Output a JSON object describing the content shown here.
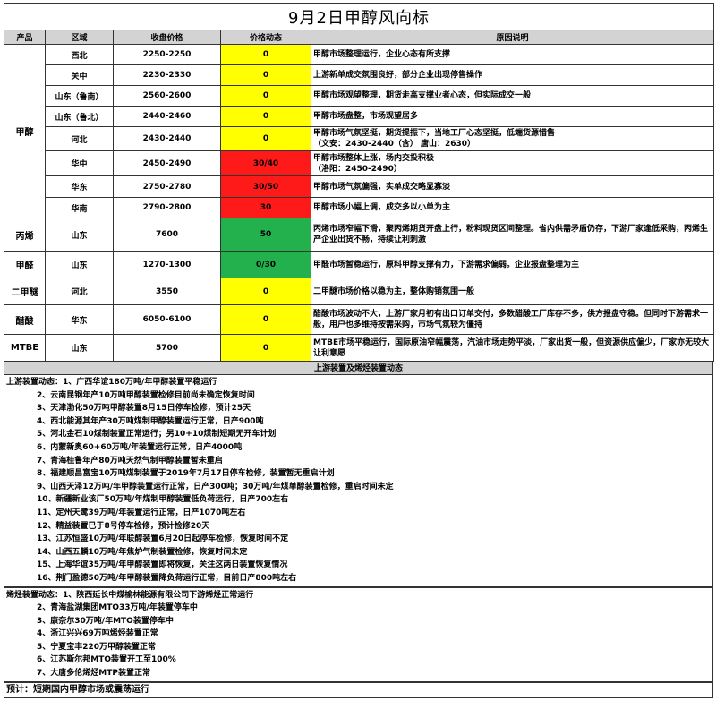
{
  "title": "9月2日甲醇风向标",
  "headers": [
    "产品",
    "区域",
    "收盘价格",
    "价格动态",
    "原因说明"
  ],
  "groups": [
    {
      "product": "甲醇",
      "rows": [
        {
          "region": "西北",
          "price": "2250-2250",
          "change": "0",
          "status": "yellow",
          "reason": "甲醇市场整理运行，企业心态有所支撑"
        },
        {
          "region": "关中",
          "price": "2230-2330",
          "change": "0",
          "status": "yellow",
          "reason": "上游新单成交氛围良好，部分企业出现停售操作"
        },
        {
          "region": "山东（鲁南）",
          "price": "2560-2600",
          "change": "0",
          "status": "yellow",
          "reason": "甲醇市场观望整理，期货走高支撑业者心态，但实际成交一般"
        },
        {
          "region": "山东（鲁北）",
          "price": "2440-2460",
          "change": "0",
          "status": "yellow",
          "reason": "甲醇市场盘整，市场观望居多"
        },
        {
          "region": "河北",
          "price": "2430-2440",
          "change": "0",
          "status": "yellow",
          "reason": "甲醇市场气氛坚挺，期货提振下，当地工厂心态坚挺，低端货源惜售\n（文安：2430-2440（含） 唐山：2630）"
        },
        {
          "region": "华中",
          "price": "2450-2490",
          "change": "30/40",
          "status": "red",
          "reason": "甲醇市场整体上涨，场内交投积极\n（洛阳：2450-2490）"
        },
        {
          "region": "华东",
          "price": "2750-2780",
          "change": "30/50",
          "status": "red",
          "reason": "甲醇市场气氛偏强，实单成交略显寡淡"
        },
        {
          "region": "华南",
          "price": "2790-2800",
          "change": "30",
          "status": "red",
          "reason": "甲醇市场小幅上调，成交多以小单为主"
        }
      ]
    },
    {
      "product": "丙烯",
      "rows": [
        {
          "region": "山东",
          "price": "7600",
          "change": "50",
          "status": "green",
          "reason": "丙烯市场窄幅下滑，聚丙烯期货开盘上行，粉料现货区间整理。省内供需矛盾仍存，下游厂家逢低采购，丙烯生产企业出货不畅，持续让利刺激"
        }
      ]
    },
    {
      "product": "甲醛",
      "rows": [
        {
          "region": "山东",
          "price": "1270-1300",
          "change": "0/30",
          "status": "green",
          "reason": "甲醛市场暂稳运行，原料甲醇支撑有力，下游需求偏弱。企业报盘整理为主"
        }
      ]
    },
    {
      "product": "二甲醚",
      "rows": [
        {
          "region": "河北",
          "price": "3550",
          "change": "0",
          "status": "yellow",
          "reason": "二甲醚市场价格以稳为主，整体购销氛围一般"
        }
      ]
    },
    {
      "product": "醋酸",
      "rows": [
        {
          "region": "华东",
          "price": "6050-6100",
          "change": "0",
          "status": "yellow",
          "reason": "醋酸市场波动不大，上游厂家月初有出口订单交付，多数醋酸工厂库存不多，供方报盘守稳。但同时下游需求一般，用户也多维持按需采购，市场气氛较为僵持"
        }
      ]
    },
    {
      "product": "MTBE",
      "rows": [
        {
          "region": "山东",
          "price": "5700",
          "change": "0",
          "status": "yellow",
          "reason": "MTBE市场平稳运行，国际原油窄幅震荡，汽油市场走势平淡，厂家出货一般，但资源供应偏少，厂家亦无较大让利意愿"
        }
      ]
    }
  ],
  "section_header": "上游装置及烯烃装置动态",
  "upstream": {
    "lead": "上游装置动态：1、广西华谊180万吨/年甲醇装置平稳运行",
    "items": [
      "2、云南昆钢年产10万吨甲醇装置检修目前尚未确定恢复时间",
      "3、天津渤化50万吨甲醇装置8月15日停车检修，预计25天",
      "4、西北能源其年产30万吨煤制甲醇装置运行正常，日产900吨",
      "5、河北金石10煤制装置正常运行；另10+10煤制短期无开车计划",
      "6、内蒙新奥60+60万吨/年装置运行正常，日产4000吨",
      "7、青海桂鲁年产80万吨天然气制甲醇装置暂未重启",
      "8、福建顺昌富宝10万吨煤制装置于2019年7月17日停车检修，装置暂无重启计划",
      "9、山西天泽12万吨/年甲醇装置运行正常，日产300吨；30万吨/年煤单醇装置检修，重启时间未定",
      "10、新疆新业该厂50万吨/年煤制甲醇装置低负荷运行，日产700左右",
      "11、定州天鹭39万吨/年装置运行正常，日产1070吨左右",
      "12、精益装置已于8号停车检修，预计检修20天",
      "13、江苏恒盛10万吨/年联醇装置6月20日起停车检修，恢复时间不定",
      "14、山西五麟10万吨/年焦炉气制装置检修，恢复时间未定",
      "15、上海华谊35万吨/年甲醇装置即将恢复，关注这两日装置恢复情况",
      "16、荆门盈德50万吨/年甲醇装置降负荷运行正常，目前日产800吨左右"
    ]
  },
  "olefin": {
    "lead": "烯烃装置动态：1、陕西延长中煤榆林能源有限公司下游烯烃正常运行",
    "items": [
      "2、青海盐湖集团MTO33万吨/年装置停车中",
      "3、康奈尔30万吨/年MTO装置停车中",
      "4、浙江兴兴69万吨烯烃装置正常",
      "5、宁夏宝丰220万甲醇装置正常",
      "6、江苏斯尔邦MTO装置开工至100%",
      "7、大唐多伦烯烃MTP装置正常"
    ]
  },
  "forecast": "预计：短期国内甲醇市场或震荡运行",
  "colors": {
    "yellow": "#ffff00",
    "red": "#ff1a1a",
    "green": "#22b14c",
    "header": "#d3d3d3"
  }
}
